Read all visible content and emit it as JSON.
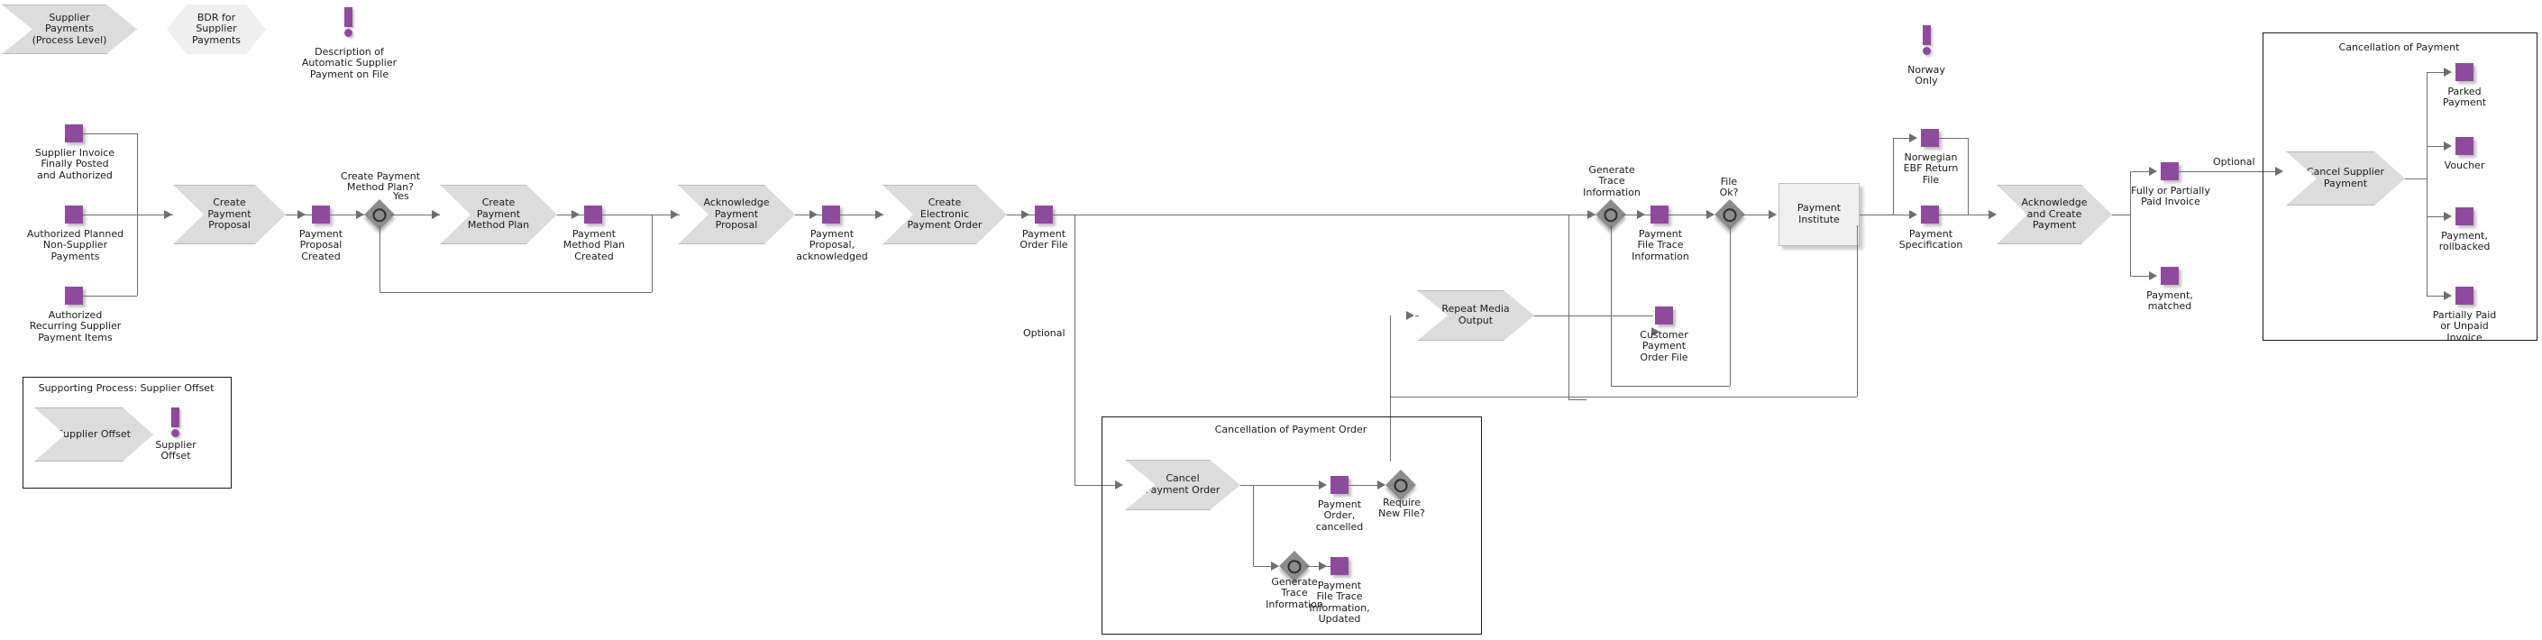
{
  "diagram": {
    "type": "epc-process-flow",
    "title_shapes": [
      {
        "id": "supplier-payments-process-level",
        "label": "Supplier\nPayments\n(Process Level)",
        "shape": "chevron"
      },
      {
        "id": "bdr-for-supplier-payments",
        "label": "BDR for\nSupplier\nPayments",
        "shape": "hexagon"
      }
    ],
    "notes": [
      {
        "id": "description-automatic-supplier-payment",
        "label": "Description of\nAutomatic Supplier\nPayment on File"
      },
      {
        "id": "norway-only",
        "label": "Norway\nOnly"
      },
      {
        "id": "supplier-offset-note",
        "label": "Supplier\nOffset"
      }
    ],
    "start_events": [
      {
        "id": "supplier-invoice-finally-posted",
        "label": "Supplier Invoice\nFinally Posted\nand Authorized"
      },
      {
        "id": "authorized-planned-non-supplier-payments",
        "label": "Authorized Planned\nNon-Supplier\nPayments"
      },
      {
        "id": "authorized-recurring-supplier-payment-items",
        "label": "Authorized\nRecurring Supplier\nPayment Items"
      }
    ],
    "functions": [
      {
        "id": "create-payment-proposal",
        "label": "Create\nPayment\nProposal"
      },
      {
        "id": "create-payment-method-plan",
        "label": "Create\nPayment\nMethod Plan"
      },
      {
        "id": "acknowledge-payment-proposal",
        "label": "Acknowledge\nPayment\nProposal"
      },
      {
        "id": "create-electronic-payment-order",
        "label": "Create\nElectronic\nPayment Order"
      },
      {
        "id": "repeat-media-output",
        "label": "Repeat Media\nOutput"
      },
      {
        "id": "acknowledge-and-create-payment",
        "label": "Acknowledge\nand Create\nPayment"
      },
      {
        "id": "cancel-payment-order",
        "label": "Cancel\nPayment Order"
      },
      {
        "id": "cancel-supplier-payment",
        "label": "Cancel Supplier\nPayment"
      },
      {
        "id": "supplier-offset",
        "label": "Supplier Offset"
      }
    ],
    "events": [
      {
        "id": "payment-proposal-created",
        "label": "Payment\nProposal\nCreated"
      },
      {
        "id": "payment-method-plan-created",
        "label": "Payment\nMethod Plan\nCreated"
      },
      {
        "id": "payment-proposal-acknowledged",
        "label": "Payment\nProposal,\nacknowledged"
      },
      {
        "id": "payment-order-file",
        "label": "Payment\nOrder File"
      },
      {
        "id": "payment-file-trace-information",
        "label": "Payment\nFile Trace\nInformation"
      },
      {
        "id": "customer-payment-order-file",
        "label": "Customer\nPayment\nOrder File"
      },
      {
        "id": "norwegian-ebf-return-file",
        "label": "Norwegian\nEBF Return\nFile"
      },
      {
        "id": "payment-specification",
        "label": "Payment\nSpecification"
      },
      {
        "id": "fully-or-partially-paid-invoice",
        "label": "Fully or Partially\nPaid Invoice"
      },
      {
        "id": "payment-matched",
        "label": "Payment,\nmatched"
      },
      {
        "id": "parked-payment",
        "label": "Parked\nPayment"
      },
      {
        "id": "voucher",
        "label": "Voucher"
      },
      {
        "id": "payment-rollbacked",
        "label": "Payment,\nrollbacked"
      },
      {
        "id": "partially-paid-or-unpaid-invoice",
        "label": "Partially Paid\nor Unpaid\nInvoice"
      },
      {
        "id": "payment-order-cancelled",
        "label": "Payment\nOrder,\ncancelled"
      },
      {
        "id": "payment-file-trace-information-updated",
        "label": "Payment\nFile Trace\nInformation,\nUpdated"
      }
    ],
    "connectors": [
      {
        "id": "create-payment-method-plan-gateway",
        "label": "Create Payment\nMethod Plan?"
      },
      {
        "id": "generate-trace-information-gateway",
        "label": "Generate\nTrace\nInformation"
      },
      {
        "id": "file-ok-gateway",
        "label": "File\nOk?"
      },
      {
        "id": "require-new-file-gateway",
        "label": "Require\nNew File?"
      },
      {
        "id": "generate-trace-information-gateway-2",
        "label": "Generate\nTrace\nInformation"
      }
    ],
    "units": [
      {
        "id": "payment-institute",
        "label": "Payment\nInstitute"
      }
    ],
    "frames": [
      {
        "id": "frame-supporting-process-supplier-offset",
        "title": "Supporting Process: Supplier Offset"
      },
      {
        "id": "frame-cancellation-of-payment-order",
        "title": "Cancellation of Payment Order"
      },
      {
        "id": "frame-cancellation-of-payment",
        "title": "Cancellation of Payment"
      }
    ],
    "edge_labels": [
      {
        "id": "edge-label-yes",
        "label": "Yes"
      },
      {
        "id": "edge-label-optional-order-file",
        "label": "Optional"
      },
      {
        "id": "edge-label-optional-cancel-payment",
        "label": "Optional"
      }
    ],
    "colors": {
      "event_purple": "#8e4b9c",
      "function_grey": "#dcdcdc",
      "connector_grey": "#8c8c8c",
      "edge_grey": "#6d6d6d",
      "unit_grey": "#f0f0f0",
      "text": "#1a1a1a"
    }
  }
}
